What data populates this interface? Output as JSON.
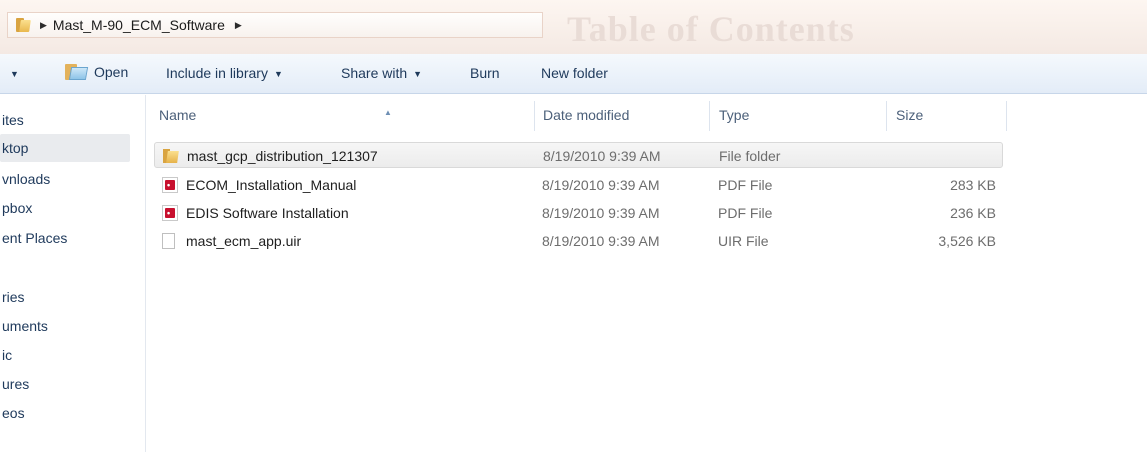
{
  "address_bar": {
    "path": [
      "Mast_M-90_ECM_Software"
    ],
    "background_text": "Table of Contents"
  },
  "toolbar": {
    "open_label": "Open",
    "include_in_library_label": "Include in library",
    "share_with_label": "Share with",
    "burn_label": "Burn",
    "new_folder_label": "New folder"
  },
  "navigation": {
    "items": [
      {
        "label": "ites",
        "selected": false
      },
      {
        "label": "ktop",
        "selected": true
      },
      {
        "label": "vnloads",
        "selected": false
      },
      {
        "label": "pbox",
        "selected": false
      },
      {
        "label": "ent Places",
        "selected": false
      },
      {
        "label": "ries",
        "selected": false
      },
      {
        "label": "uments",
        "selected": false
      },
      {
        "label": "ic",
        "selected": false
      },
      {
        "label": "ures",
        "selected": false
      },
      {
        "label": "eos",
        "selected": false
      }
    ]
  },
  "file_list": {
    "columns": {
      "name": "Name",
      "date_modified": "Date modified",
      "type": "Type",
      "size": "Size"
    },
    "rows": [
      {
        "icon": "folder-icon",
        "name": "mast_gcp_distribution_121307",
        "date": "8/19/2010 9:39 AM",
        "type": "File folder",
        "size": "",
        "selected": true
      },
      {
        "icon": "pdf-icon",
        "name": "ECOM_Installation_Manual",
        "date": "8/19/2010 9:39 AM",
        "type": "PDF File",
        "size": "283 KB",
        "selected": false
      },
      {
        "icon": "pdf-icon",
        "name": "EDIS Software Installation",
        "date": "8/19/2010 9:39 AM",
        "type": "PDF File",
        "size": "236 KB",
        "selected": false
      },
      {
        "icon": "file-icon",
        "name": "mast_ecm_app.uir",
        "date": "8/19/2010 9:39 AM",
        "type": "UIR File",
        "size": "3,526 KB",
        "selected": false
      }
    ]
  }
}
